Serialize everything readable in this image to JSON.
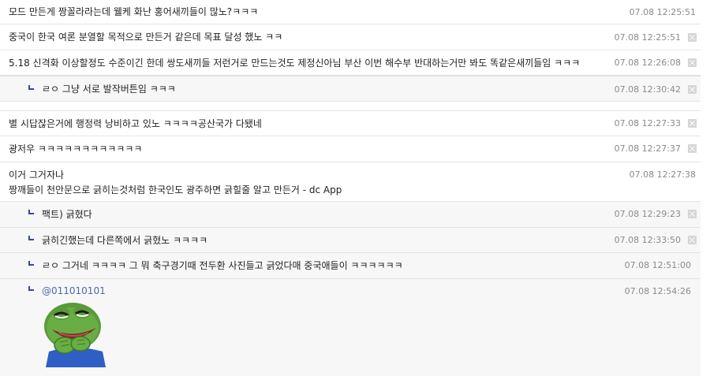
{
  "comments": [
    {
      "text": "모드 만든게 짱꼴라라는데 웰케 화난 홍어새끼들이 많노?ㅋㅋㅋ",
      "date": "07.08 12:25:51"
    },
    {
      "text": "중국이 한국 여론 분열할 목적으로 만든거 같은데 목표 달성 했노 ㅋㅋ",
      "date": "07.08 12:25:51"
    },
    {
      "text": "5.18 신격화 이상할정도 수준이긴 한데 쌍도새끼들 저런거로 만드는것도 제정신아님 부산 이번 해수부 반대하는거만 봐도 똑같은새끼들임 ㅋㅋㅋ",
      "date": "07.08 12:26:08"
    },
    {
      "text": "ㄹㅇ 그냥 서로 발작버튼임 ㅋㅋㅋ",
      "date": "07.08 12:30:42"
    },
    {
      "text": "별 시답잖은거에 행정력 낭비하고 있노 ㅋㅋㅋㅋ공산국가 다됐네",
      "date": "07.08 12:27:33"
    },
    {
      "text": "광저우 ㅋㅋㅋㅋㅋㅋㅋㅋㅋㅋㅋㅋ",
      "date": "07.08 12:27:37"
    },
    {
      "text_line1": "이거 그거자나",
      "text_line2": "짱깨들이 천안문으로 긁히는것처럼 한국인도 광주하면 긁힐줄 알고 만든거 - dc App",
      "date": "07.08 12:27:38"
    },
    {
      "text": "팩트) 긁혔다",
      "date": "07.08 12:29:23"
    },
    {
      "text": "긁히긴했는데 다른쪽에서 긁혔노 ㅋㅋㅋㅋ",
      "date": "07.08 12:33:50"
    },
    {
      "text": "ㄹㅇ 그거네 ㅋㅋㅋㅋ 그 뭐 축구경기때 전두환 사진들고 긁었다매 중국애들이 ㅋㅋㅋㅋㅋㅋ",
      "date": "07.08 12:51:00"
    },
    {
      "mention": "@011010101",
      "date": "07.08 12:54:26",
      "sticker": "pepe-frog-laughing-sticker"
    }
  ],
  "colors": {
    "reply_arrow": "#3c44a0",
    "mention": "#4e6aa6",
    "date": "#8a8a8a"
  }
}
